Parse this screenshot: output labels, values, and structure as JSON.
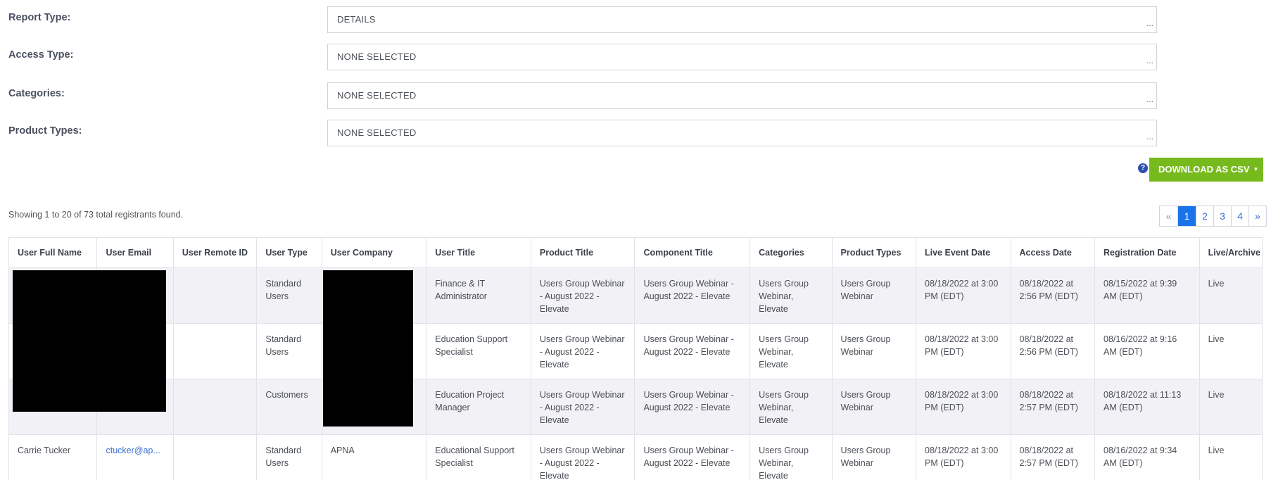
{
  "filters": [
    {
      "label": "Report Type:",
      "value": "DETAILS",
      "more": "..."
    },
    {
      "label": "Access Type:",
      "value": "NONE SELECTED",
      "more": "..."
    },
    {
      "label": "Categories:",
      "value": "NONE SELECTED",
      "more": "..."
    },
    {
      "label": "Product Types:",
      "value": "NONE SELECTED",
      "more": "..."
    }
  ],
  "help_icon": "?",
  "download_button": {
    "label": "DOWNLOAD AS CSV",
    "caret": "▼"
  },
  "showing_text": "Showing 1 to 20 of 73 total registrants found.",
  "pagination": {
    "prev": "«",
    "pages": [
      "1",
      "2",
      "3",
      "4"
    ],
    "active": "1",
    "next": "»"
  },
  "table": {
    "headers": [
      "User Full Name",
      "User Email",
      "User Remote ID",
      "User Type",
      "User Company",
      "User Title",
      "Product Title",
      "Component Title",
      "Categories",
      "Product Types",
      "Live Event Date",
      "Access Date",
      "Registration Date",
      "Live/Archive"
    ],
    "rows": [
      {
        "full_name": "",
        "email": "",
        "remote_id": "",
        "type": "Standard Users",
        "company": "",
        "title": "Finance & IT Administrator",
        "product_title": "Users Group Webinar - August 2022 - Elevate",
        "component_title": "Users Group Webinar - August 2022 - Elevate",
        "categories": "Users Group Webinar, Elevate",
        "product_types": "Users Group Webinar",
        "live_event_date": "08/18/2022 at 3:00 PM (EDT)",
        "access_date": "08/18/2022 at 2:56 PM (EDT)",
        "registration_date": "08/15/2022 at 9:39 AM (EDT)",
        "live_archive": "Live"
      },
      {
        "full_name": "",
        "email": "",
        "remote_id": "",
        "type": "Standard Users",
        "company": "",
        "title": "Education Support Specialist",
        "product_title": "Users Group Webinar - August 2022 - Elevate",
        "component_title": "Users Group Webinar - August 2022 - Elevate",
        "categories": "Users Group Webinar, Elevate",
        "product_types": "Users Group Webinar",
        "live_event_date": "08/18/2022 at 3:00 PM (EDT)",
        "access_date": "08/18/2022 at 2:56 PM (EDT)",
        "registration_date": "08/16/2022 at 9:16 AM (EDT)",
        "live_archive": "Live"
      },
      {
        "full_name": "",
        "email": "",
        "remote_id": "",
        "type": "Customers",
        "company": "",
        "title": "Education Project Manager",
        "product_title": "Users Group Webinar - August 2022 - Elevate",
        "component_title": "Users Group Webinar - August 2022 - Elevate",
        "categories": "Users Group Webinar, Elevate",
        "product_types": "Users Group Webinar",
        "live_event_date": "08/18/2022 at 3:00 PM (EDT)",
        "access_date": "08/18/2022 at 2:57 PM (EDT)",
        "registration_date": "08/18/2022 at 11:13 AM (EDT)",
        "live_archive": "Live"
      },
      {
        "full_name": "Carrie Tucker",
        "email": "ctucker@ap...",
        "remote_id": "",
        "type": "Standard Users",
        "company": "APNA",
        "title": "Educational Support Specialist",
        "product_title": "Users Group Webinar - August 2022 - Elevate",
        "component_title": "Users Group Webinar - August 2022 - Elevate",
        "categories": "Users Group Webinar, Elevate",
        "product_types": "Users Group Webinar",
        "live_event_date": "08/18/2022 at 3:00 PM (EDT)",
        "access_date": "08/18/2022 at 2:57 PM (EDT)",
        "registration_date": "08/16/2022 at 9:34 AM (EDT)",
        "live_archive": "Live"
      }
    ]
  },
  "colors": {
    "accent_green": "#77ba1d",
    "pager_active": "#1a73e8",
    "link": "#3c6fd6",
    "row_shade": "#f2f1f6"
  }
}
